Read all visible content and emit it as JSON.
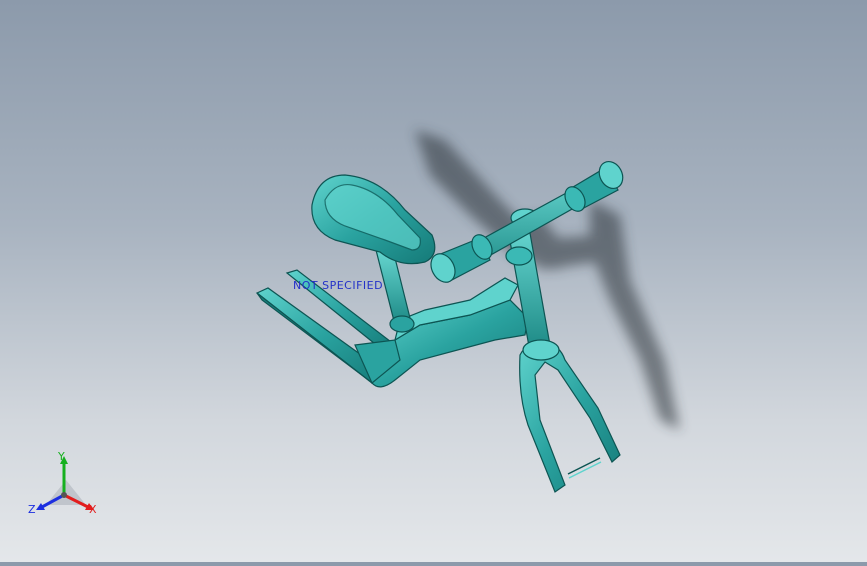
{
  "viewport": {
    "background_top": "#8c9aab",
    "background_bottom": "#e4e7ea",
    "part_color": "#2aa3a0"
  },
  "annotation": {
    "text": "NOT SPECIFIED",
    "color": "#2432c8"
  },
  "triad": {
    "x_label": "X",
    "y_label": "Y",
    "z_label": "Z",
    "x_color": "#e21d1d",
    "y_color": "#16b01f",
    "z_color": "#1c2fe0"
  },
  "model": {
    "icon": "balance-bike-model"
  }
}
